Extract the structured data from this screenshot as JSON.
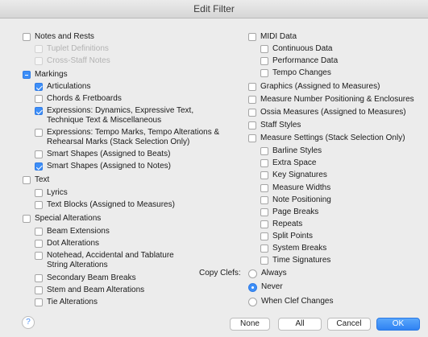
{
  "window": {
    "title": "Edit Filter"
  },
  "left": {
    "notes_and_rests": "Notes and Rests",
    "tuplet_definitions": "Tuplet Definitions",
    "cross_staff_notes": "Cross-Staff Notes",
    "markings": "Markings",
    "articulations": "Articulations",
    "chords_fretboards": "Chords & Fretboards",
    "expressions_dynamics": "Expressions: Dynamics, Expressive Text, Technique Text & Miscellaneous",
    "expressions_tempo": "Expressions: Tempo Marks, Tempo Alterations & Rehearsal Marks (Stack Selection Only)",
    "smart_shapes_beats": "Smart Shapes (Assigned to Beats)",
    "smart_shapes_notes": "Smart Shapes (Assigned to Notes)",
    "text": "Text",
    "lyrics": "Lyrics",
    "text_blocks": "Text Blocks (Assigned to Measures)",
    "special_alterations": "Special Alterations",
    "beam_extensions": "Beam Extensions",
    "dot_alterations": "Dot Alterations",
    "notehead_alterations": "Notehead, Accidental and Tablature String Alterations",
    "secondary_beam_breaks": "Secondary Beam Breaks",
    "stem_beam_alterations": "Stem and Beam Alterations",
    "tie_alterations": "Tie Alterations"
  },
  "right": {
    "midi_data": "MIDI Data",
    "continuous_data": "Continuous Data",
    "performance_data": "Performance Data",
    "tempo_changes": "Tempo Changes",
    "graphics": "Graphics (Assigned to Measures)",
    "measure_number_positioning": "Measure Number Positioning & Enclosures",
    "ossia_measures": "Ossia Measures (Assigned to Measures)",
    "staff_styles": "Staff Styles",
    "measure_settings": "Measure Settings (Stack Selection Only)",
    "barline_styles": "Barline Styles",
    "extra_space": "Extra Space",
    "key_signatures": "Key Signatures",
    "measure_widths": "Measure Widths",
    "note_positioning": "Note Positioning",
    "page_breaks": "Page Breaks",
    "repeats": "Repeats",
    "split_points": "Split Points",
    "system_breaks": "System Breaks",
    "time_signatures": "Time Signatures"
  },
  "copy_clefs": {
    "label": "Copy Clefs:",
    "always": "Always",
    "never": "Never",
    "when_clef_changes": "When Clef Changes",
    "selected": "Never"
  },
  "buttons": {
    "help": "?",
    "none": "None",
    "all": "All",
    "cancel": "Cancel",
    "ok": "OK"
  },
  "colors": {
    "accent": "#3d8ef7",
    "background": "#ececec"
  }
}
